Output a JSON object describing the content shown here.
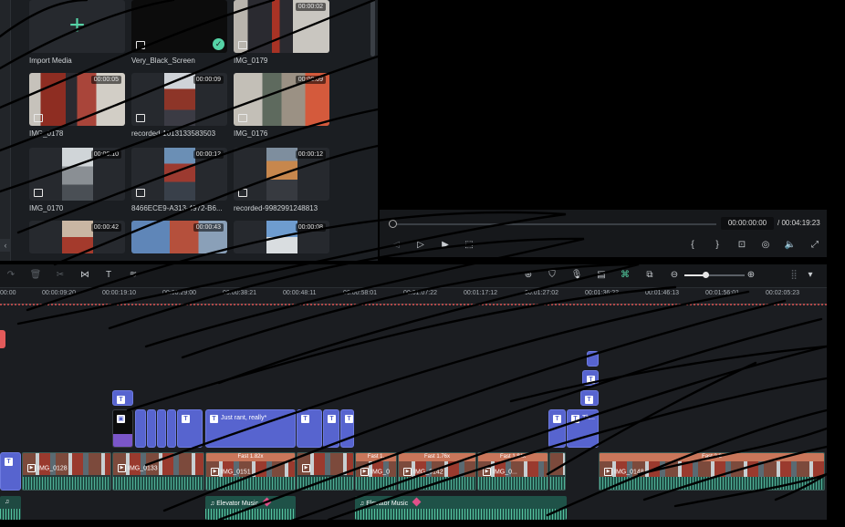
{
  "media": {
    "items": [
      {
        "label": "Import Media",
        "type": "import"
      },
      {
        "label": "Very_Black_Screen",
        "type": "image",
        "duration": ""
      },
      {
        "label": "IMG_0179",
        "type": "video",
        "duration": "00:00:02"
      },
      {
        "label": "IMG_0178",
        "type": "video",
        "duration": "00:00:05"
      },
      {
        "label": "recorded-1013133583503",
        "type": "video",
        "duration": "00:00:09"
      },
      {
        "label": "IMG_0176",
        "type": "video",
        "duration": "00:00:09"
      },
      {
        "label": "IMG_0170",
        "type": "video",
        "duration": "00:00:10"
      },
      {
        "label": "8466ECE9-A313-4972-B6...",
        "type": "video",
        "duration": "00:00:12"
      },
      {
        "label": "recorded-9982991248813",
        "type": "video",
        "duration": "00:00:12"
      },
      {
        "label": "",
        "type": "video",
        "duration": "00:00:42"
      },
      {
        "label": "",
        "type": "video",
        "duration": "00:00:43"
      },
      {
        "label": "",
        "type": "video",
        "duration": "00:00:08"
      }
    ],
    "collapse_glyph": "‹"
  },
  "player": {
    "current_time": "00:00:00:00",
    "total_time": "/ 00:04:19:23",
    "progress": 0,
    "left_controls": [
      "◁",
      "▷",
      "▶",
      "⬚"
    ],
    "right_controls": [
      "{",
      "}",
      "⊡",
      "◎",
      "🔈",
      "⤢"
    ]
  },
  "toolbar": {
    "left_icons": [
      "↷",
      "🗑",
      "✂",
      "⋈",
      "T",
      "≋"
    ],
    "right_icons": [
      "⊛",
      "⛉",
      "🎙",
      "▤",
      "⌘",
      "⧉"
    ],
    "zoom_out": "⊖",
    "zoom_in": "⊕",
    "zoom_level": 0.36,
    "grid_icon": "⣿",
    "dropdown": "▾"
  },
  "ruler": {
    "ticks": [
      "00:00",
      "00:00:09:20",
      "00:00:19:10",
      "00:00:29:00",
      "00:00:38:21",
      "00:00:48:11",
      "00:00:58:01",
      "00:01:07:22",
      "00:01:17:12",
      "00:01:27:02",
      "00:01:36:23",
      "00:01:46:13",
      "00:01:56:01",
      "00:02:05:23"
    ]
  },
  "tracks": {
    "title_clips": [
      {
        "label": ""
      },
      {
        "label": ""
      },
      {
        "label": "Just rant, really*"
      },
      {
        "label": ""
      },
      {
        "label": ""
      },
      {
        "label": ""
      },
      {
        "label": "Th..."
      },
      {
        "label": ""
      },
      {
        "label": ""
      }
    ],
    "video_clips": [
      {
        "label": "IMG_0128",
        "speed": ""
      },
      {
        "label": "IMG_0133",
        "speed": ""
      },
      {
        "label": "IMG_0151",
        "speed": "Fast 1.82x"
      },
      {
        "label": "",
        "speed": ""
      },
      {
        "label": "IMG_0",
        "speed": "Fast 1."
      },
      {
        "label": "IMG_0142",
        "speed": "Fast 1.76x"
      },
      {
        "label": "IMG_0...",
        "speed": "Fast 1.84x"
      },
      {
        "label": "IMG_0148",
        "speed": "Fast 2.8"
      }
    ],
    "audio_clips": [
      {
        "label": "Elevator Music"
      },
      {
        "label": "Elevator Music"
      }
    ]
  }
}
